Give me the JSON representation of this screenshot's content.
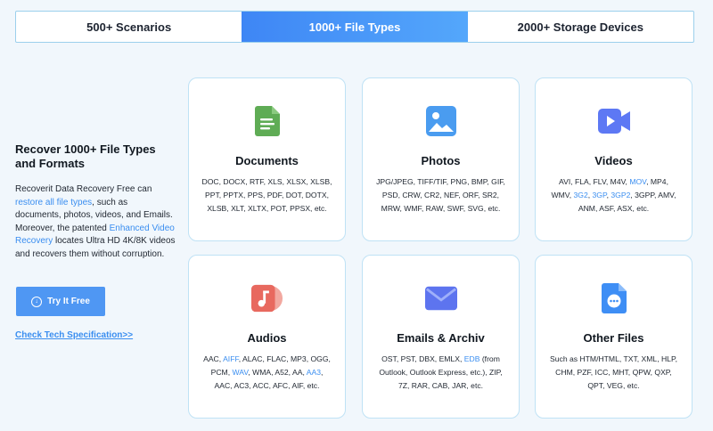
{
  "tabs": [
    {
      "label": "500+ Scenarios"
    },
    {
      "label": "1000+ File Types"
    },
    {
      "label": "2000+ Storage Devices"
    }
  ],
  "intro": {
    "title": "Recover 1000+ File Types and Formats",
    "p1": "Recoverit Data Recovery Free can ",
    "link1": "restore all file types",
    "p2": ", such as documents, photos, videos, and Emails. Moreover, the patented ",
    "link2": "Enhanced Video Recovery",
    "p3": " locates Ultra HD 4K/8K videos and recovers them without corruption."
  },
  "cta": {
    "try_label": "Try It Free",
    "spec_link": "Check Tech Specification>>"
  },
  "cards": [
    {
      "title": "Documents",
      "icon": "document-icon",
      "color": "#5fac55",
      "desc": [
        "DOC, DOCX, RTF, XLS, XLSX, XLSB,",
        "PPT, PPTX, PPS, PDF, DOT, DOTX,",
        "XLSB, XLT, XLTX, POT, PPSX, etc."
      ]
    },
    {
      "title": "Photos",
      "icon": "photo-icon",
      "color": "#4a9cf0",
      "desc": [
        "JPG/JPEG, TIFF/TIF, PNG, BMP, GIF,",
        "PSD, CRW, CR2, NEF, ORF, SR2,",
        "MRW, WMF, RAW, SWF, SVG, etc."
      ]
    },
    {
      "title": "Videos",
      "icon": "video-icon",
      "color": "#5d78f4",
      "line1a": "AVI, FLA, FLV, M4V, ",
      "line1b": "MOV",
      "line1c": ", MP4,",
      "line2a": "WMV, ",
      "line2b": "3G2",
      "line2c": ", ",
      "line2d": "3GP",
      "line2e": ", ",
      "line2f": "3GP2",
      "line2g": ", 3GPP, AMV,",
      "line3": "ANM, ASF, ASX, etc."
    },
    {
      "title": "Audios",
      "icon": "audio-icon",
      "color": "#e8695f",
      "line1a": "AAC, ",
      "line1b": "AIFF",
      "line1c": ", ALAC, FLAC, MP3, OGG,",
      "line2a": "PCM, ",
      "line2b": "WAV",
      "line2c": ", WMA, A52, AA, ",
      "line2d": "AA3",
      "line2e": ",",
      "line3": "AAC, AC3, ACC, AFC, AIF, etc."
    },
    {
      "title": "Emails & Archiv",
      "icon": "email-icon",
      "color": "#5d74ef",
      "line1a": "OST, PST, DBX, EMLX, ",
      "line1b": "EDB",
      "line1c": " (from",
      "line2": "Outlook, Outlook Express, etc.), ZIP,",
      "line3": "7Z, RAR, CAB, JAR, etc."
    },
    {
      "title": "Other Files",
      "icon": "other-file-icon",
      "color": "#3e8ef5",
      "desc": [
        "Such as HTM/HTML, TXT, XML, HLP,",
        "CHM, PZF, ICC, MHT, QPW, QXP,",
        "QPT, VEG, etc."
      ]
    }
  ]
}
